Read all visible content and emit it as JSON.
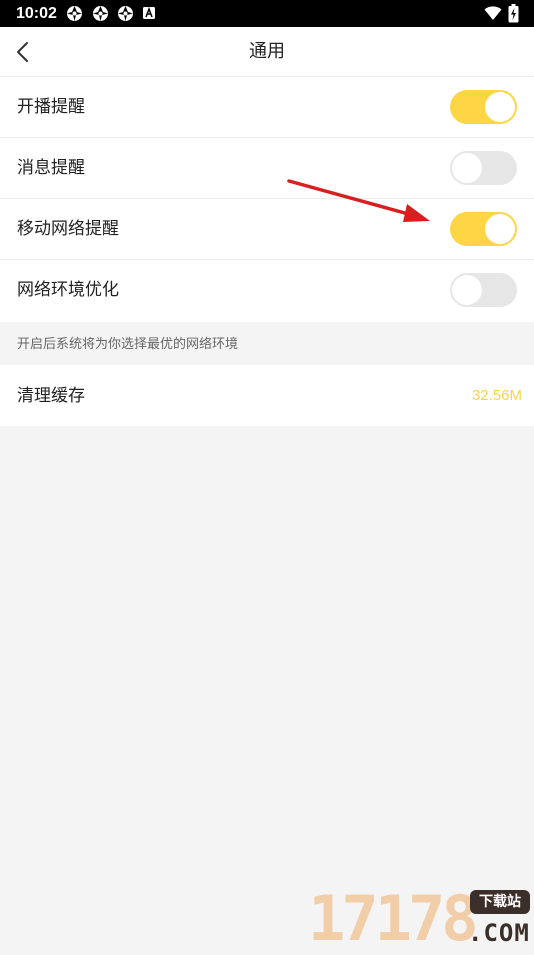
{
  "status_bar": {
    "time": "10:02",
    "notification_icons": [
      "aperture-icon",
      "aperture-icon",
      "aperture-icon",
      "keyboard-a-icon"
    ],
    "right_icons": [
      "wifi-icon",
      "battery-charging-icon"
    ]
  },
  "header": {
    "title": "通用",
    "back_icon": "chevron-left-icon"
  },
  "settings": {
    "items": [
      {
        "label": "开播提醒",
        "enabled": true
      },
      {
        "label": "消息提醒",
        "enabled": false
      },
      {
        "label": "移动网络提醒",
        "enabled": true
      },
      {
        "label": "网络环境优化",
        "enabled": false
      }
    ],
    "hint": "开启后系统将为你选择最优的网络环境"
  },
  "cache": {
    "label": "清理缓存",
    "size": "32.56M"
  },
  "watermark": {
    "digits": "17178",
    "badge": "下载站",
    "domain": ".COM"
  },
  "colors": {
    "accent": "#fdd545",
    "switch_off": "#e6e6e6",
    "cache_text": "#fad346",
    "annotation_arrow": "#d81e1e"
  }
}
